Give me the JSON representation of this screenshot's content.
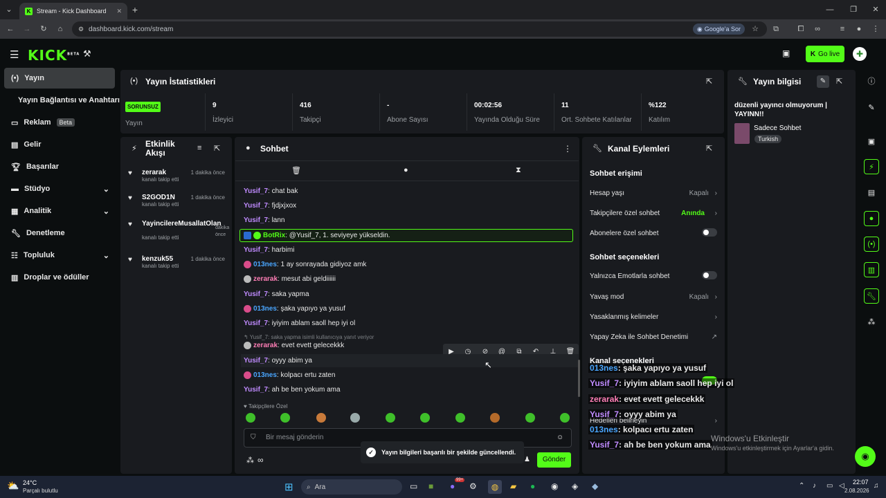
{
  "browser": {
    "tab_title": "Stream - Kick Dashboard",
    "url": "dashboard.kick.com/stream",
    "google_btn": "Google'a Sor"
  },
  "app": {
    "logo": "KICK",
    "logo_badge": "BETA",
    "go_live": "Go live"
  },
  "sidenav": [
    {
      "label": "Yayın",
      "icon": "broadcast-icon"
    },
    {
      "label": "Yayın Bağlantısı ve Anahtarı",
      "icon": ""
    },
    {
      "label": "Reklam",
      "icon": "ad-icon",
      "badge": "Beta"
    },
    {
      "label": "Gelir",
      "icon": "chart-icon"
    },
    {
      "label": "Başarılar",
      "icon": "trophy-icon"
    },
    {
      "label": "Stüdyo",
      "icon": "studio-icon"
    },
    {
      "label": "Analitik",
      "icon": "analytics-icon"
    },
    {
      "label": "Denetleme",
      "icon": "wrench-icon"
    },
    {
      "label": "Topluluk",
      "icon": "community-icon"
    },
    {
      "label": "Droplar ve ödüller",
      "icon": "drops-icon"
    }
  ],
  "stats": {
    "title": "Yayın İstatistikleri",
    "status": "SORUNSUZ",
    "status_label": "Yayın",
    "items": [
      {
        "value": "9",
        "label": "İzleyici"
      },
      {
        "value": "416",
        "label": "Takipçi"
      },
      {
        "value": "-",
        "label": "Abone Sayısı"
      },
      {
        "value": "00:02:56",
        "label": "Yayında Olduğu Süre"
      },
      {
        "value": "11",
        "label": "Ort. Sohbete Katılanlar"
      },
      {
        "value": "%122",
        "label": "Katılım"
      }
    ]
  },
  "info": {
    "title": "Yayın bilgisi",
    "stream_title": "düzenli yayıncı olmuyorum | YAYINN!!",
    "category": "Sadece Sohbet",
    "language": "Turkish"
  },
  "activity": {
    "title": "Etkinlik Akışı",
    "events": [
      {
        "name": "zerarak",
        "time": "1 dakika önce",
        "sub": "kanalı takip etti"
      },
      {
        "name": "S2GOD1N",
        "time": "1 dakika önce",
        "sub": "kanalı takip etti"
      },
      {
        "name": "YayincilereMusallatOlan",
        "time": "dakika önce",
        "sub": "kanalı takip etti"
      },
      {
        "name": "kenzuk55",
        "time": "1 dakika önce",
        "sub": "kanalı takip etti"
      }
    ]
  },
  "chat": {
    "title": "Sohbet",
    "messages": [
      {
        "user": "Yusif_7",
        "text": ": chat bak"
      },
      {
        "user": "Yusif_7",
        "text": ": fjdjxjxox"
      },
      {
        "user": "Yusif_7",
        "text": ": lann"
      },
      {
        "user": "BotRix",
        "text": ": @Yusif_7, 1. seviyeye yükseldin."
      },
      {
        "user": "Yusif_7",
        "text": ": harbimi"
      },
      {
        "user": "013nes",
        "text": ": 1 ay sonrayada gidiyoz amk"
      },
      {
        "user": "zerarak",
        "text": ": mesut abi geldiiiiii"
      },
      {
        "user": "Yusif_7",
        "text": ": saka yapma"
      },
      {
        "user": "013nes",
        "text": ": şaka yapıyo ya yusuf"
      },
      {
        "user": "Yusif_7",
        "text": ": iyiyim ablam saoll hep iyi ol"
      },
      {
        "user": "zerarak",
        "text": ": evet evett gelecekkk"
      },
      {
        "user": "Yusif_7",
        "text": ": oyyy abim ya"
      },
      {
        "user": "013nes",
        "text": ": kolpacı ertu zaten"
      },
      {
        "user": "Yusif_7",
        "text": ": ah be ben yokum ama"
      }
    ],
    "reply_note": "Yusif_7: saka yapma isimli kullanıcıya yanıt veriyor",
    "followers_only": "Takipçilere Özel",
    "placeholder": "Bir mesaj gönderin",
    "send": "Gönder"
  },
  "actions": {
    "title": "Kanal Eylemleri",
    "chat_access": "Sohbet erişimi",
    "account_age": "Hesap yaşı",
    "account_age_val": "Kapalı",
    "followers_chat": "Takipçilere özel sohbet",
    "followers_chat_val": "Anında",
    "subs_chat": "Abonelere özel sohbet",
    "chat_options": "Sohbet seçenekleri",
    "emote_only": "Yalnızca Emotlarla sohbet",
    "slow_mode": "Yavaş mod",
    "slow_mode_val": "Kapalı",
    "banned_words": "Yasaklanmış kelimeler",
    "ai_mod": "Yapay Zeka ile Sohbet Denetimi",
    "channel_options": "Kanal seçenekleri",
    "goals": "Hedefleri belirleyin"
  },
  "overlay": [
    {
      "user": "013nes",
      "text": ": şaka yapıyo ya yusuf"
    },
    {
      "user": "Yusif_7",
      "text": ": iyiyim ablam saoll hep iyi ol"
    },
    {
      "user": "zerarak",
      "text": ": evet evett gelecekkk"
    },
    {
      "user": "Yusif_7",
      "text": ": oyyy abim ya"
    },
    {
      "user": "013nes",
      "text": ": kolpacı ertu zaten"
    },
    {
      "user": "Yusif_7",
      "text": ": ah be ben yokum ama"
    }
  ],
  "toast": "Yayın bilgileri başarılı bir şekilde güncellendi.",
  "watermark": {
    "title": "Windows'u Etkinleştir",
    "sub": "Windows'u etkinleştirmek için Ayarlar'a gidin."
  },
  "taskbar": {
    "temp": "24°C",
    "weather": "Parçalı bulutlu",
    "search": "Ara",
    "time": "22:07",
    "date": "2.08.2026",
    "badge": "99+"
  },
  "colors": {
    "accent": "#53fc18",
    "panel": "#191b1f",
    "bg": "#0b0e0f"
  }
}
